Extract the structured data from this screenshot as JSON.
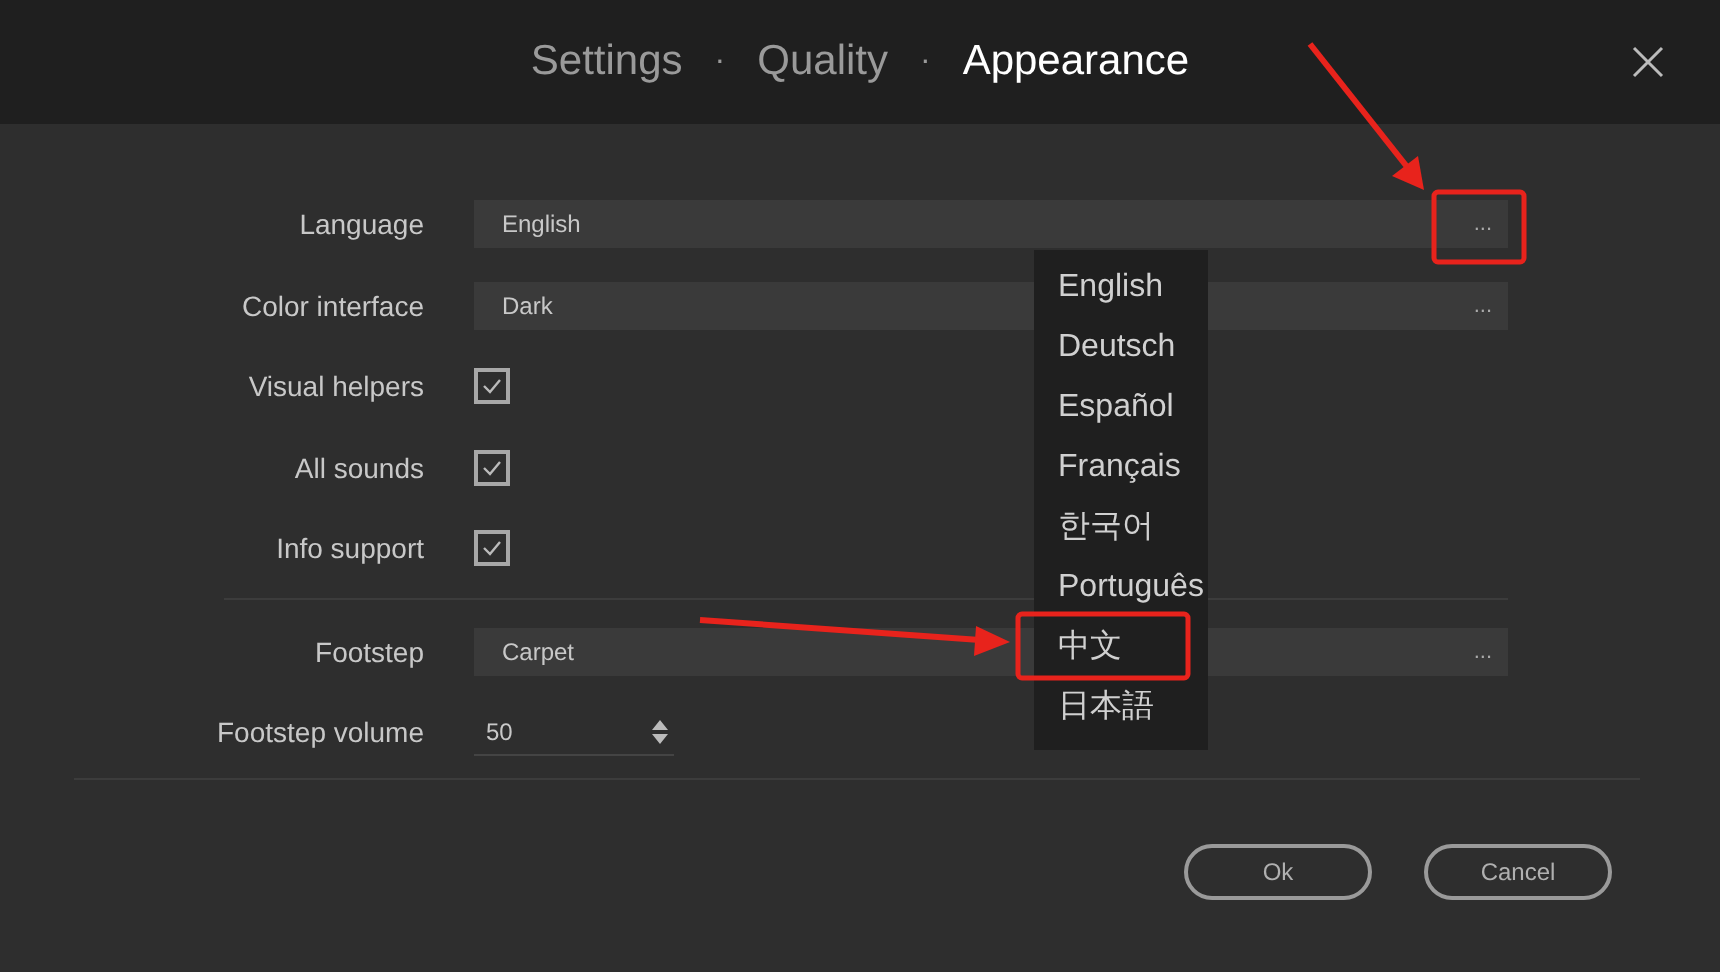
{
  "header": {
    "tabs": [
      {
        "label": "Settings",
        "selected": false
      },
      {
        "label": "Quality",
        "selected": false
      },
      {
        "label": "Appearance",
        "selected": true
      }
    ],
    "separator": "·"
  },
  "groups": [
    {
      "rows": [
        {
          "kind": "select",
          "label": "Language",
          "value": "English",
          "more": "..."
        },
        {
          "kind": "select",
          "label": "Color interface",
          "value": "Dark",
          "more": "..."
        },
        {
          "kind": "checkbox",
          "label": "Visual helpers",
          "checked": true
        },
        {
          "kind": "checkbox",
          "label": "All sounds",
          "checked": true
        },
        {
          "kind": "checkbox",
          "label": "Info support",
          "checked": true
        }
      ]
    },
    {
      "rows": [
        {
          "kind": "select",
          "label": "Footstep",
          "value": "Carpet",
          "more": "..."
        },
        {
          "kind": "spinner",
          "label": "Footstep volume",
          "value": "50"
        }
      ]
    }
  ],
  "dropdown": {
    "items": [
      "English",
      "Deutsch",
      "Español",
      "Français",
      "한국어",
      "Português",
      "中文",
      "日本語"
    ]
  },
  "buttons": [
    "Ok",
    "Cancel"
  ]
}
